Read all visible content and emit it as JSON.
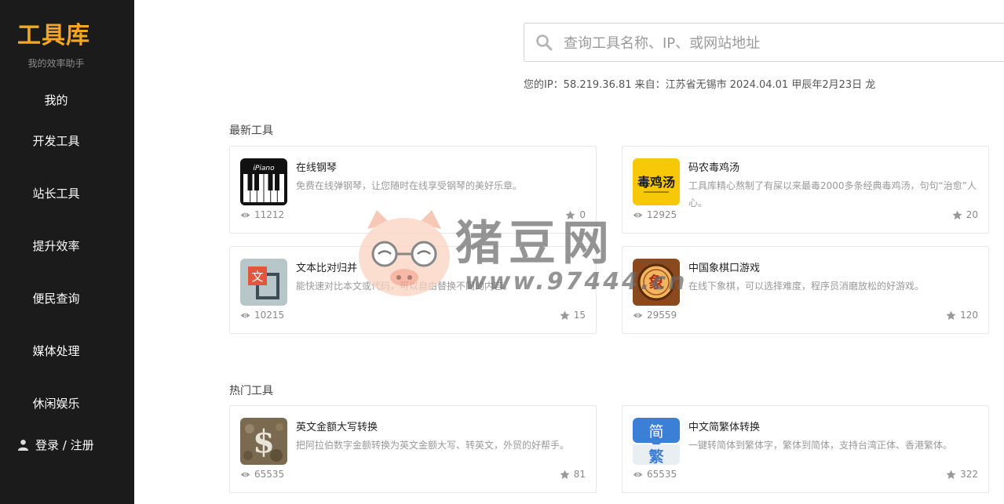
{
  "sidebar": {
    "logo": "工具库",
    "tagline": "我的效率助手",
    "items": [
      {
        "label": "我的"
      },
      {
        "label": "开发工具"
      },
      {
        "label": "站长工具"
      },
      {
        "label": "提升效率"
      },
      {
        "label": "便民查询"
      },
      {
        "label": "媒体处理"
      },
      {
        "label": "休闲娱乐"
      }
    ],
    "login": "登录 / 注册"
  },
  "search": {
    "placeholder": "查询工具名称、IP、或网站地址",
    "value": ""
  },
  "ipinfo": "您的IP：58.219.36.81 来自：江苏省无锡市 2024.04.01 甲辰年2月23日 龙",
  "sections": {
    "newest": {
      "title": "最新工具",
      "cards": [
        {
          "title": "在线钢琴",
          "desc": "免费在线弹钢琴，让您随时在线享受钢琴的美好乐章。",
          "views": "11212",
          "stars": "0",
          "icon": "piano-icon",
          "icon_label": "iPiano"
        },
        {
          "title": "码农毒鸡汤",
          "desc": "工具库精心熬制了有屎以来最毒2000多条经典毒鸡汤，句句“治愈”人心。",
          "views": "12925",
          "stars": "20",
          "icon": "poison-soup-icon",
          "icon_label": "毒鸡汤"
        },
        {
          "title": "文本比对归并",
          "desc": "能快速对比本文或代码，可以自由替换不同的内容。",
          "views": "10215",
          "stars": "15",
          "icon": "text-compare-icon",
          "icon_label": "文"
        },
        {
          "title": "中国象棋口游戏",
          "desc": "在线下象棋，可以选择难度，程序员消磨放松的好游戏。",
          "views": "29559",
          "stars": "120",
          "icon": "chinese-chess-icon",
          "icon_label": "象"
        }
      ]
    },
    "popular": {
      "title": "热门工具",
      "cards": [
        {
          "title": "英文金额大写转换",
          "desc": "把阿拉伯数字金额转换为英文金额大写、转英文，外贸的好帮手。",
          "views": "65535",
          "stars": "81",
          "icon": "dollar-icon",
          "icon_label": "$"
        },
        {
          "title": "中文简繁体转换",
          "desc": "一键转简体到繁体字，繁体到简体，支持台湾正体、香港繁体。",
          "views": "65535",
          "stars": "322",
          "icon": "simplified-traditional-icon",
          "icon_label_top": "简",
          "icon_label_bottom": "繁"
        }
      ]
    }
  },
  "watermark": {
    "text": "猪豆网",
    "url": "www.97444.cn"
  },
  "colors": {
    "sidebar_bg": "#1b1b1b",
    "logo": "#f5a623",
    "accent_blue": "#3b7fd6"
  }
}
